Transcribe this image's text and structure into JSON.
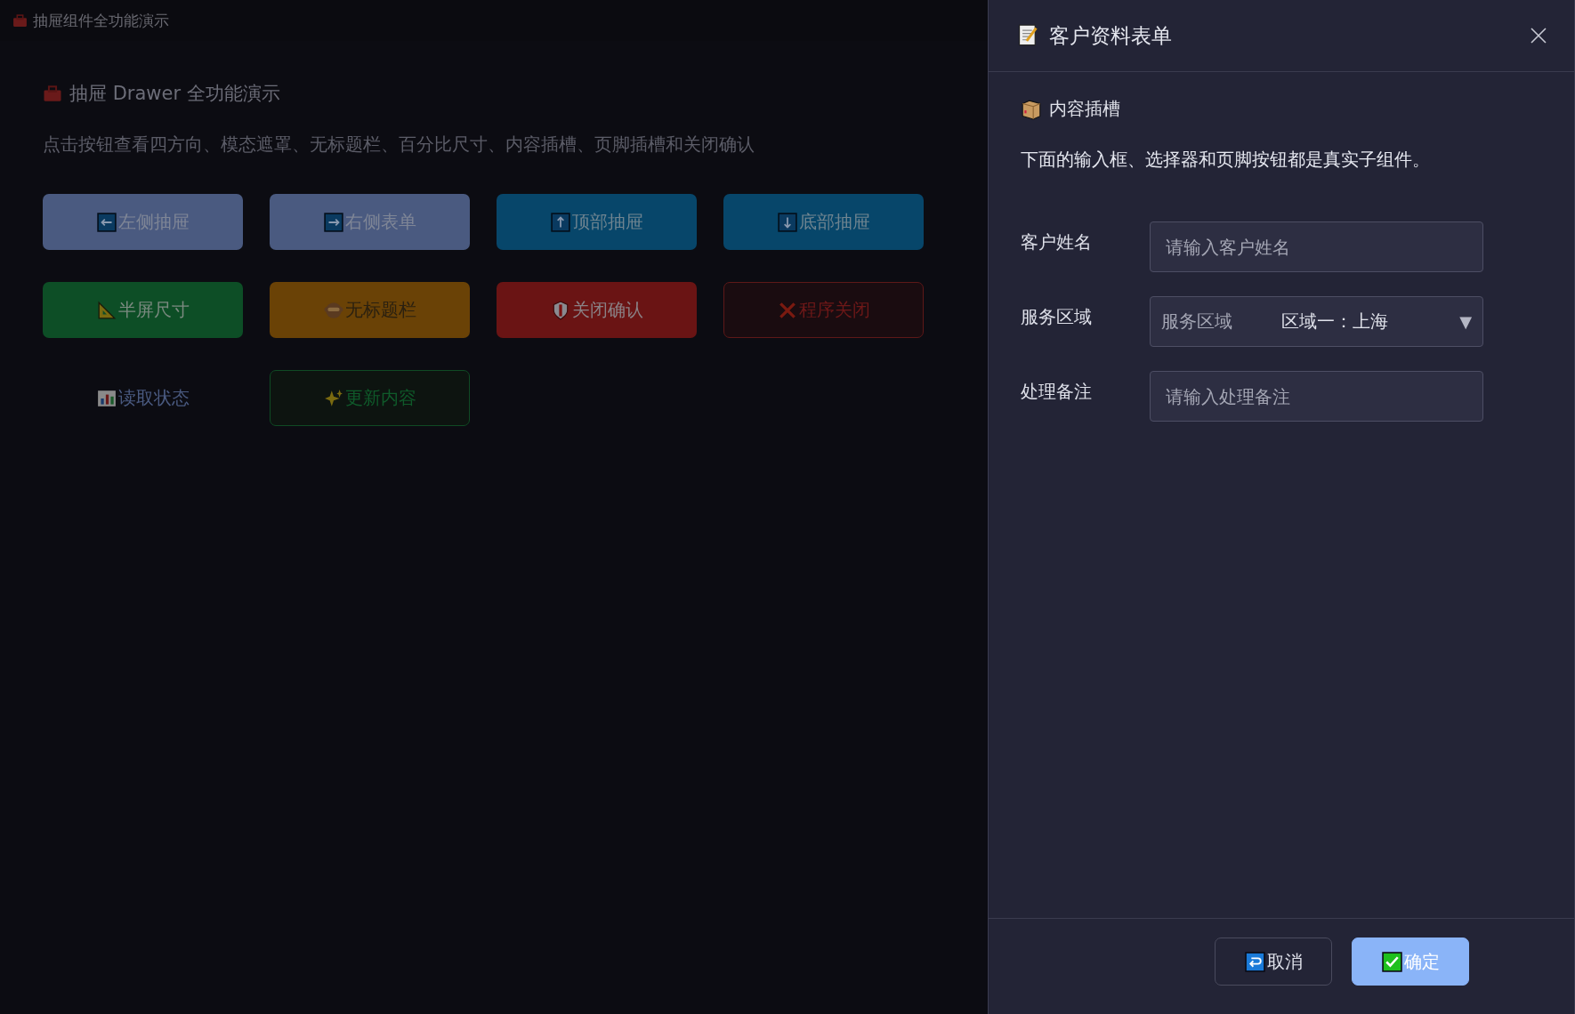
{
  "window": {
    "title": "抽屉组件全功能演示"
  },
  "page": {
    "heading": "抽屉 Drawer 全功能演示",
    "description": "点击按钮查看四方向、模态遮罩、无标题栏、百分比尺寸、内容插槽、页脚插槽和关闭确认"
  },
  "buttons": [
    {
      "label": "左侧抽屉",
      "kind": "slate"
    },
    {
      "label": "右侧表单",
      "kind": "slate"
    },
    {
      "label": "顶部抽屉",
      "kind": "info"
    },
    {
      "label": "底部抽屉",
      "kind": "info"
    },
    {
      "label": "半屏尺寸",
      "kind": "success"
    },
    {
      "label": "无标题栏",
      "kind": "warning"
    },
    {
      "label": "关闭确认",
      "kind": "danger"
    },
    {
      "label": "程序关闭",
      "kind": "danger-outline"
    },
    {
      "label": "读取状态",
      "kind": "text"
    },
    {
      "label": "更新内容",
      "kind": "success-outline"
    }
  ],
  "drawer": {
    "title": "客户资料表单",
    "section_title": "内容插槽",
    "intro": "下面的输入框、选择器和页脚按钮都是真实子组件。",
    "fields": [
      {
        "label": "客户姓名",
        "kind": "input",
        "placeholder": "请输入客户姓名"
      },
      {
        "label": "服务区域",
        "kind": "select",
        "prefix": "服务区域",
        "value": "区域一：上海",
        "arrow": "▼"
      },
      {
        "label": "处理备注",
        "kind": "input",
        "placeholder": "请输入处理备注"
      }
    ],
    "footer_buttons": [
      {
        "label": "取消",
        "kind": "secondary"
      },
      {
        "label": "确定",
        "kind": "primary"
      }
    ]
  }
}
